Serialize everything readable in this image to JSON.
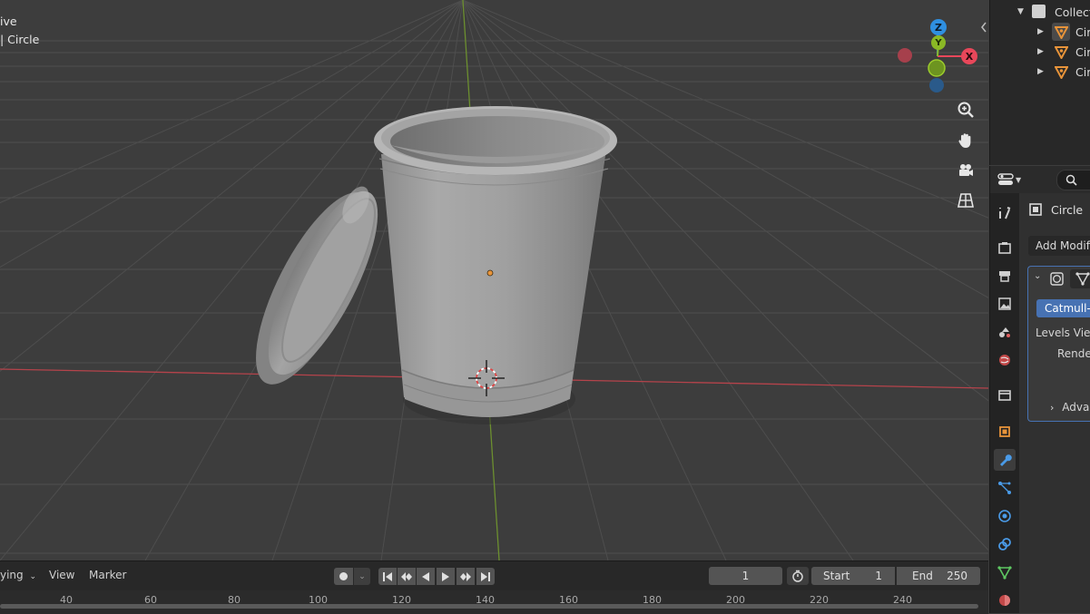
{
  "viewport": {
    "mode_text": "ive",
    "object_text": "| Circle",
    "gizmo": {
      "z_label": "Z",
      "y_label": "Y",
      "x_label": "X"
    },
    "tools": [
      "zoom-icon",
      "hand-icon",
      "camera-icon",
      "grid-icon"
    ]
  },
  "outliner": {
    "collection_label": "Collect",
    "items": [
      {
        "label": "Cir"
      },
      {
        "label": "Cir"
      },
      {
        "label": "Cir"
      }
    ]
  },
  "properties": {
    "object_name": "Circle",
    "add_modifier_label": "Add Modifi",
    "modifier_type_label": "Catmull-C",
    "levels_label": "Levels Vie",
    "render_label": "Rende",
    "advanced_label": "Adva"
  },
  "timeline": {
    "playback_label": "ying",
    "view_label": "View",
    "marker_label": "Marker",
    "current_frame": "1",
    "start_label": "Start",
    "start_value": "1",
    "end_label": "End",
    "end_value": "250",
    "ruler_numbers": [
      "40",
      "60",
      "80",
      "100",
      "120",
      "140",
      "160",
      "180",
      "200",
      "220",
      "240"
    ]
  },
  "colors": {
    "viewport_bg": "#3d3d3d",
    "grid_line": "#4f4f4f",
    "x_axis": "#b5434b",
    "y_axis": "#6c8f2f",
    "gizmo_x": "#e8475a",
    "gizmo_y": "#8ab825",
    "gizmo_z": "#2f8fe0",
    "accent_blue": "#4772b3",
    "object_orange": "#d9893a"
  }
}
